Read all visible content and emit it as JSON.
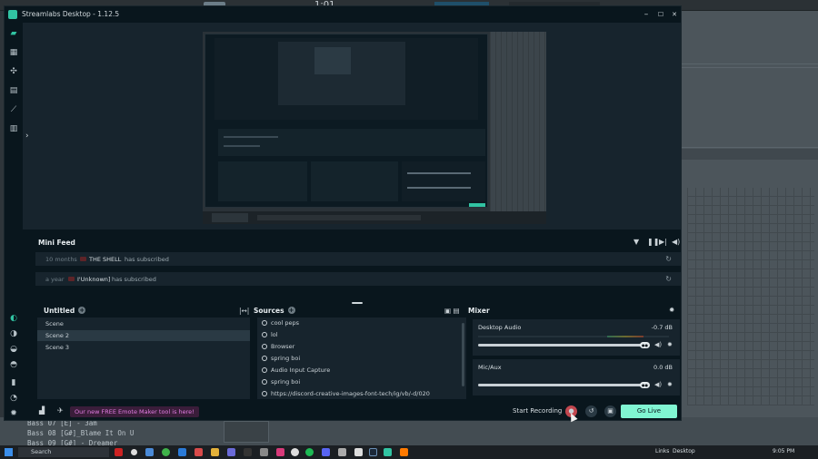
{
  "window": {
    "title": "Streamlabs Desktop - 1.12.5",
    "minimize": "–",
    "maximize": "☐",
    "close": "✕"
  },
  "daw": {
    "topbar_time": "1:01",
    "tracks": [
      "Bass 07 [E] - 3am",
      "Bass 08 [G#]_Blame It On U",
      "Bass 09 [G#] - Dreamer"
    ]
  },
  "minifeed": {
    "title": "Mini Feed",
    "items": [
      {
        "time": "10 months",
        "name": "THE SHELL",
        "action": "has subscribed"
      },
      {
        "time": "a year",
        "name": "I'Unknown]",
        "action": "has subscribed"
      }
    ]
  },
  "scenes": {
    "title": "Untitled",
    "items": [
      "Scene",
      "Scene 2",
      "Scene 3"
    ],
    "selected_index": 1
  },
  "sources": {
    "title": "Sources",
    "items": [
      "cool peps",
      "lol",
      "Browser",
      "spring boi",
      "Audio Input Capture",
      "spring boi",
      "https://discord-creative-images-font-tech/ig/vb/-d/020"
    ]
  },
  "mixer": {
    "title": "Mixer",
    "channels": [
      {
        "name": "Desktop Audio",
        "db": "-0.7 dB",
        "level": 0.95
      },
      {
        "name": "Mic/Aux",
        "db": "0.0 dB",
        "level": 0.93
      }
    ]
  },
  "footer": {
    "promo": "Our new FREE Emote Maker tool is here!",
    "start_recording": "Start Recording",
    "go_live": "Go Live"
  },
  "taskbar": {
    "search": "Search",
    "links": "Links",
    "desktop": "Desktop",
    "time": "9:05 PM"
  },
  "colors": {
    "accent": "#31c3a2",
    "go_live": "#80f5d2",
    "record": "#c2474f",
    "promo": "#e27de2"
  }
}
